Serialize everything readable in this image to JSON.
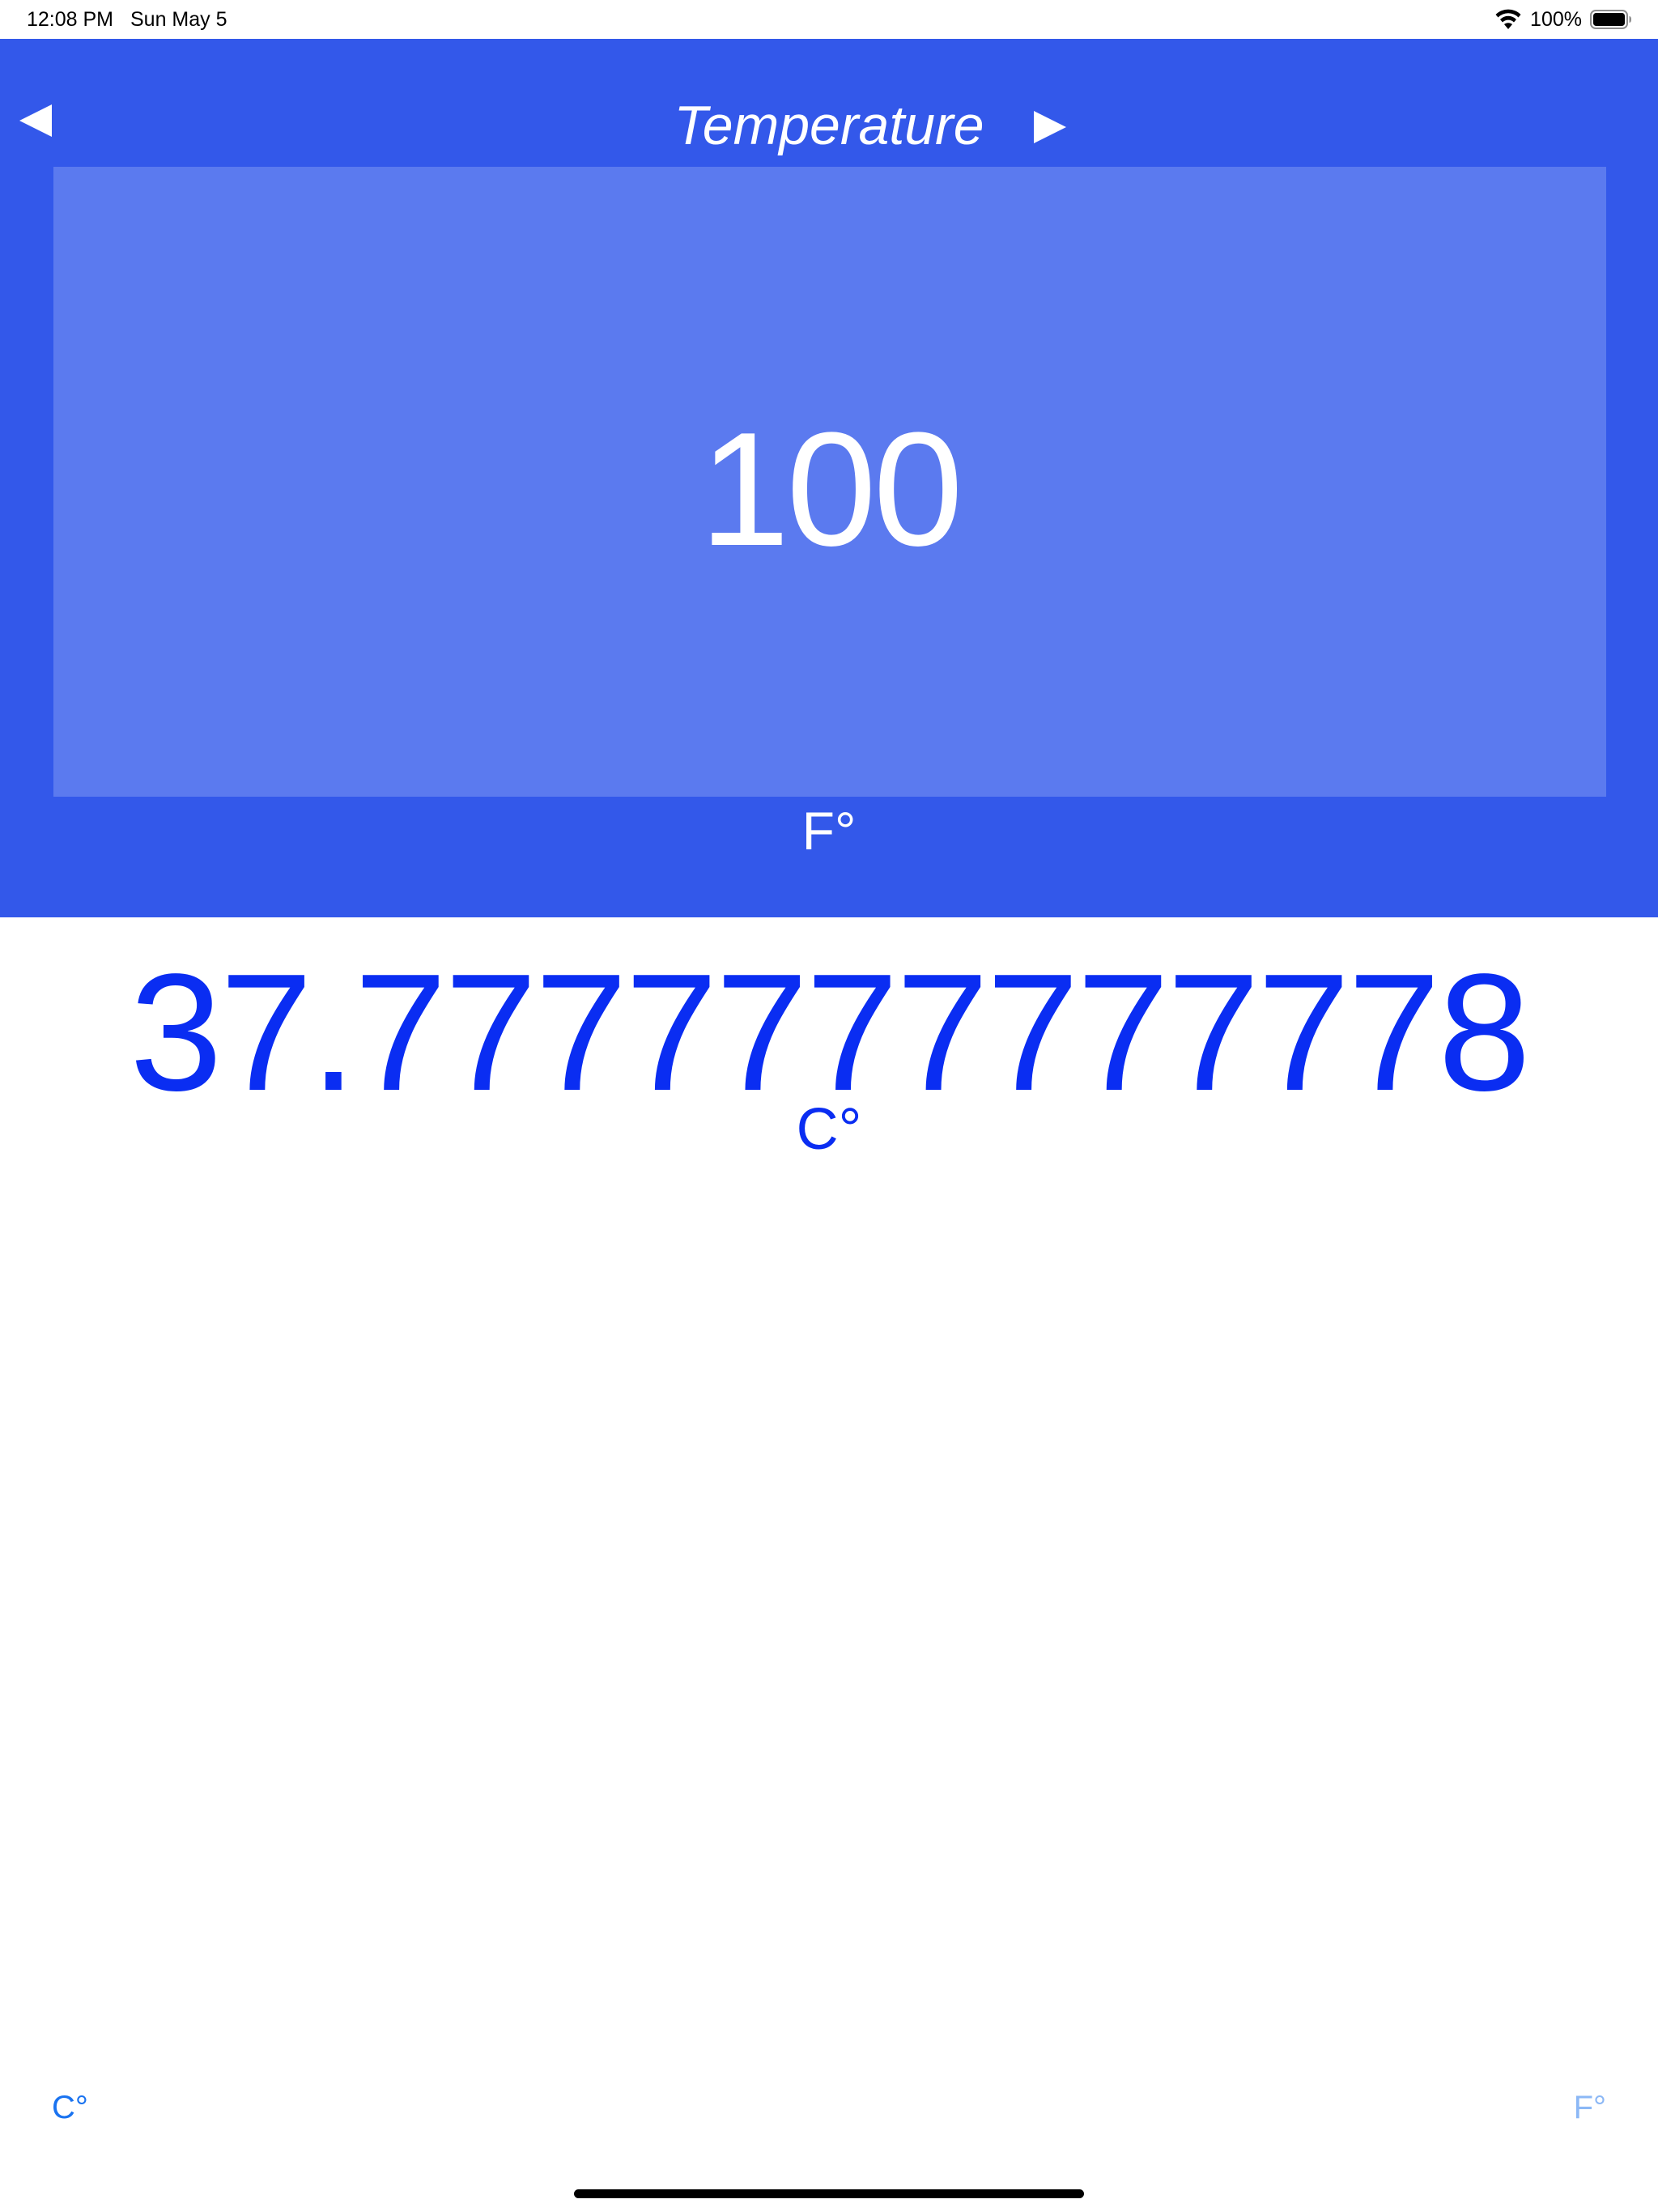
{
  "status_bar": {
    "time": "12:08 PM",
    "date": "Sun May 5",
    "battery": "100%"
  },
  "header": {
    "title": "Temperature",
    "prev_icon": "left-triangle-icon",
    "next_icon": "right-triangle-icon"
  },
  "input": {
    "value": "100",
    "unit": "F°"
  },
  "result": {
    "value": "37.7777777777778",
    "unit": "C°"
  },
  "tabs": {
    "celsius_label": "C°",
    "fahrenheit_label": "F°"
  },
  "colors": {
    "header_bg": "#3358EA",
    "input_bg": "#5B7AEF",
    "result_text": "#0A2DF2",
    "active_tab": "#1A73F0",
    "inactive_tab": "#8CB8F6"
  }
}
